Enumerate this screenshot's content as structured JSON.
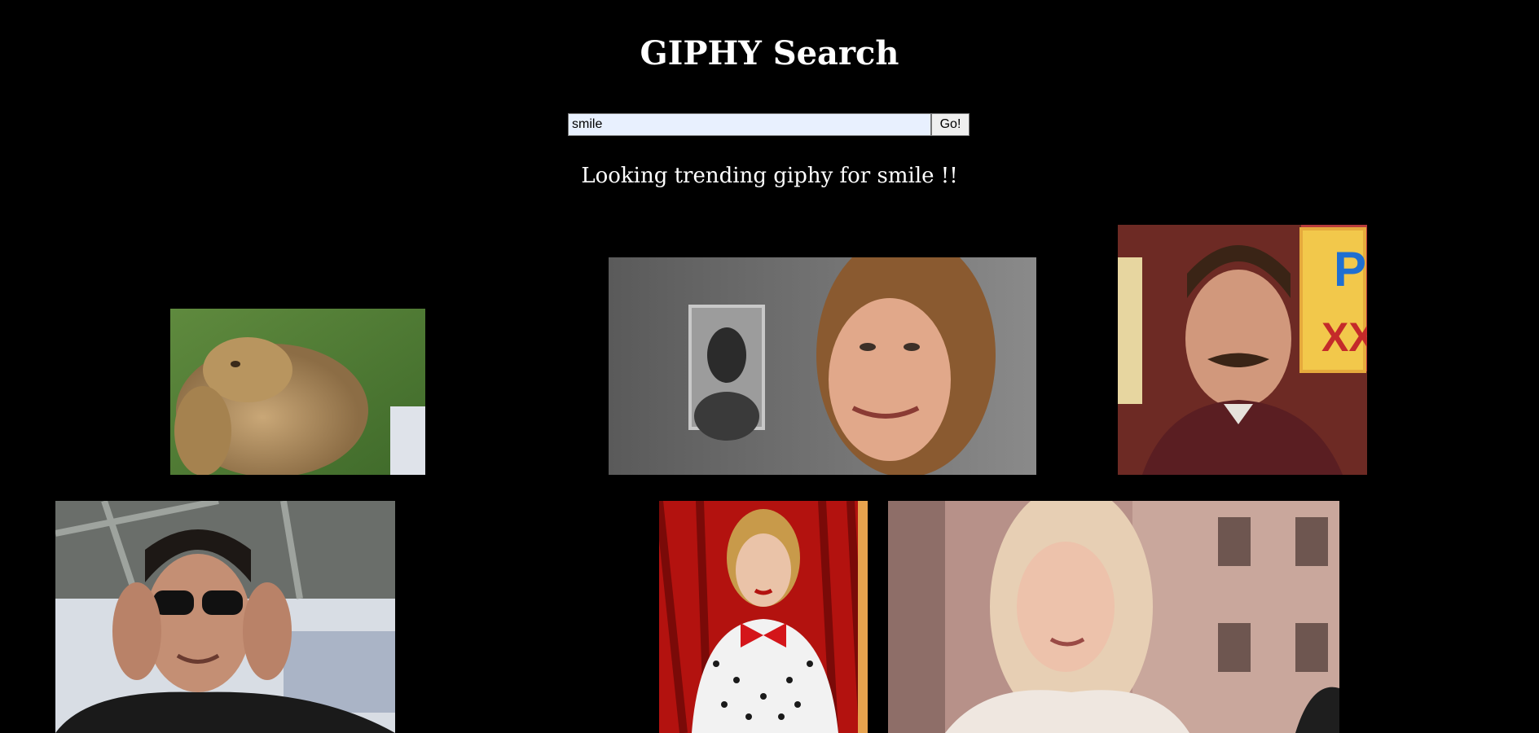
{
  "page": {
    "title": "GIPHY Search"
  },
  "search": {
    "value": "smile",
    "button_label": "Go!"
  },
  "status": {
    "message": "Looking trending giphy for smile !!"
  },
  "results": [
    {
      "name": "gif-bunny",
      "subject": "smiling bunny"
    },
    {
      "name": "gif-woman-smiling",
      "subject": "woman with brown hair smiling"
    },
    {
      "name": "gif-man-mustache",
      "subject": "man with mustache smiling"
    },
    {
      "name": "gif-man-sunglasses",
      "subject": "man putting on sunglasses"
    },
    {
      "name": "gif-woman-bowtie",
      "subject": "woman with red bow tie"
    },
    {
      "name": "gif-woman-blonde",
      "subject": "blonde woman smiling"
    }
  ],
  "colors": {
    "background": "#000000",
    "text": "#ffffff",
    "input_bg": "#e8f0fe"
  }
}
